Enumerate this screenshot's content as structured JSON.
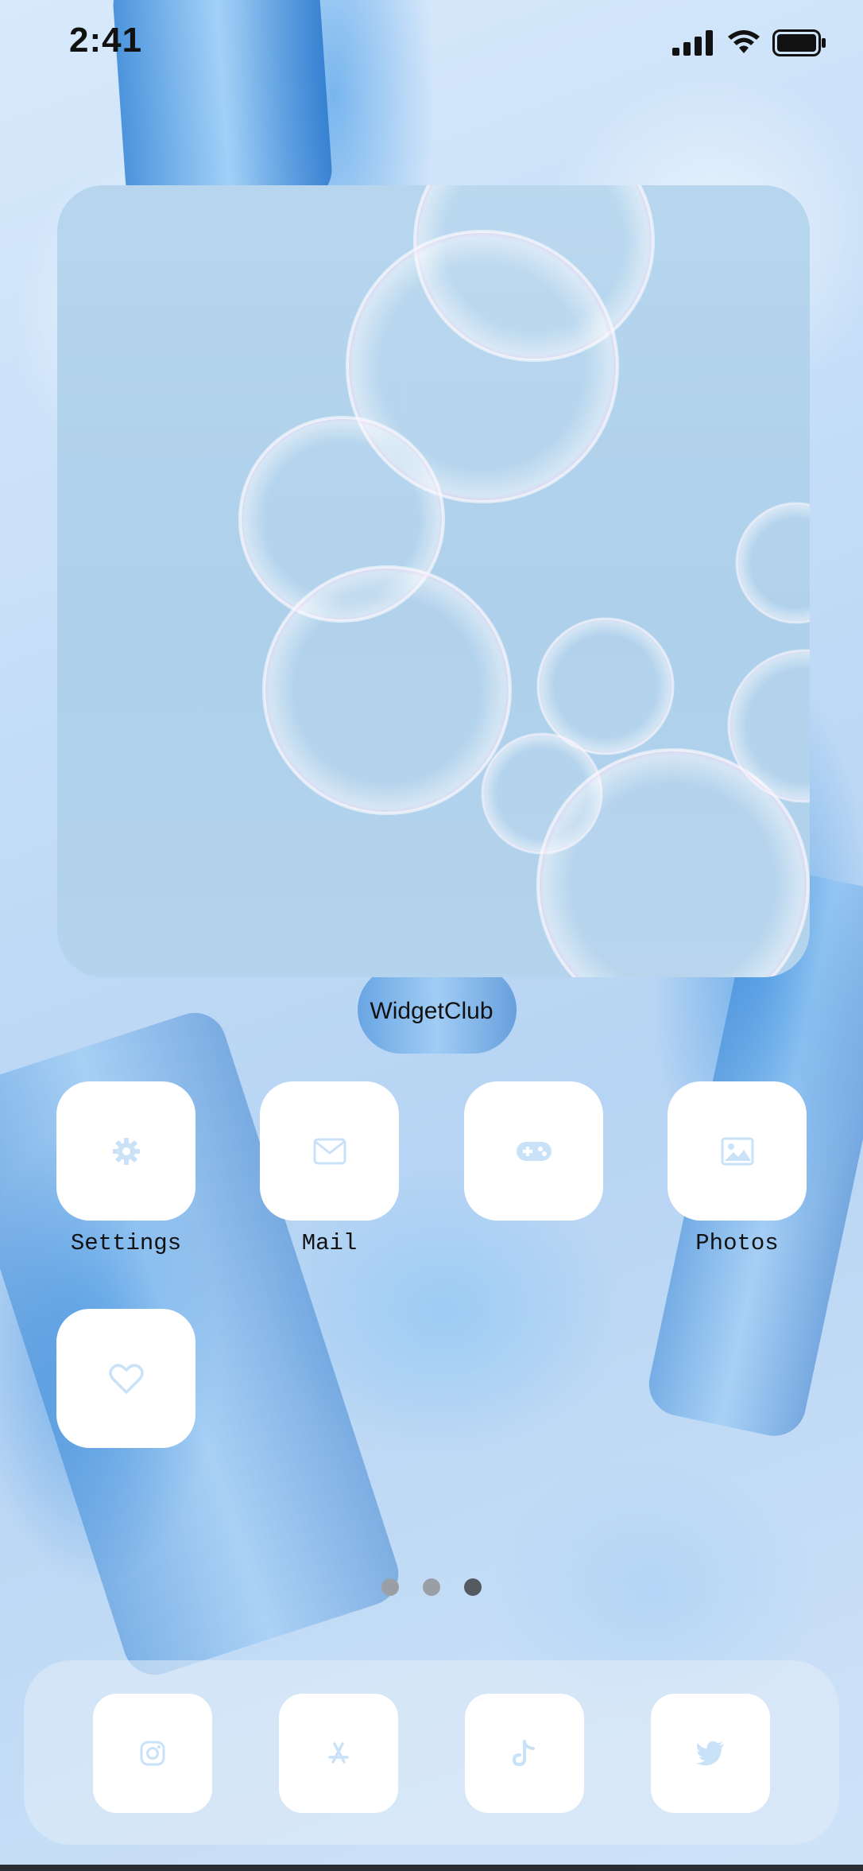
{
  "status_bar": {
    "time": "2:41"
  },
  "widget": {
    "label": "WidgetClub"
  },
  "apps": [
    {
      "label": "Settings",
      "icon": "gear-icon"
    },
    {
      "label": "Mail",
      "icon": "envelope-icon"
    },
    {
      "label": "",
      "icon": "gamepad-icon"
    },
    {
      "label": "Photos",
      "icon": "image-icon"
    },
    {
      "label": "",
      "icon": "heart-icon"
    }
  ],
  "dock": [
    {
      "icon": "instagram-icon"
    },
    {
      "icon": "app-store-icon"
    },
    {
      "icon": "tiktok-icon"
    },
    {
      "icon": "twitter-icon"
    }
  ],
  "page_indicator": {
    "count": 3,
    "active_index": 2
  },
  "colors": {
    "icon_tint": "#c9e2f8",
    "tile_background": "#ffffff",
    "widget_background": "#b0d1ec"
  }
}
